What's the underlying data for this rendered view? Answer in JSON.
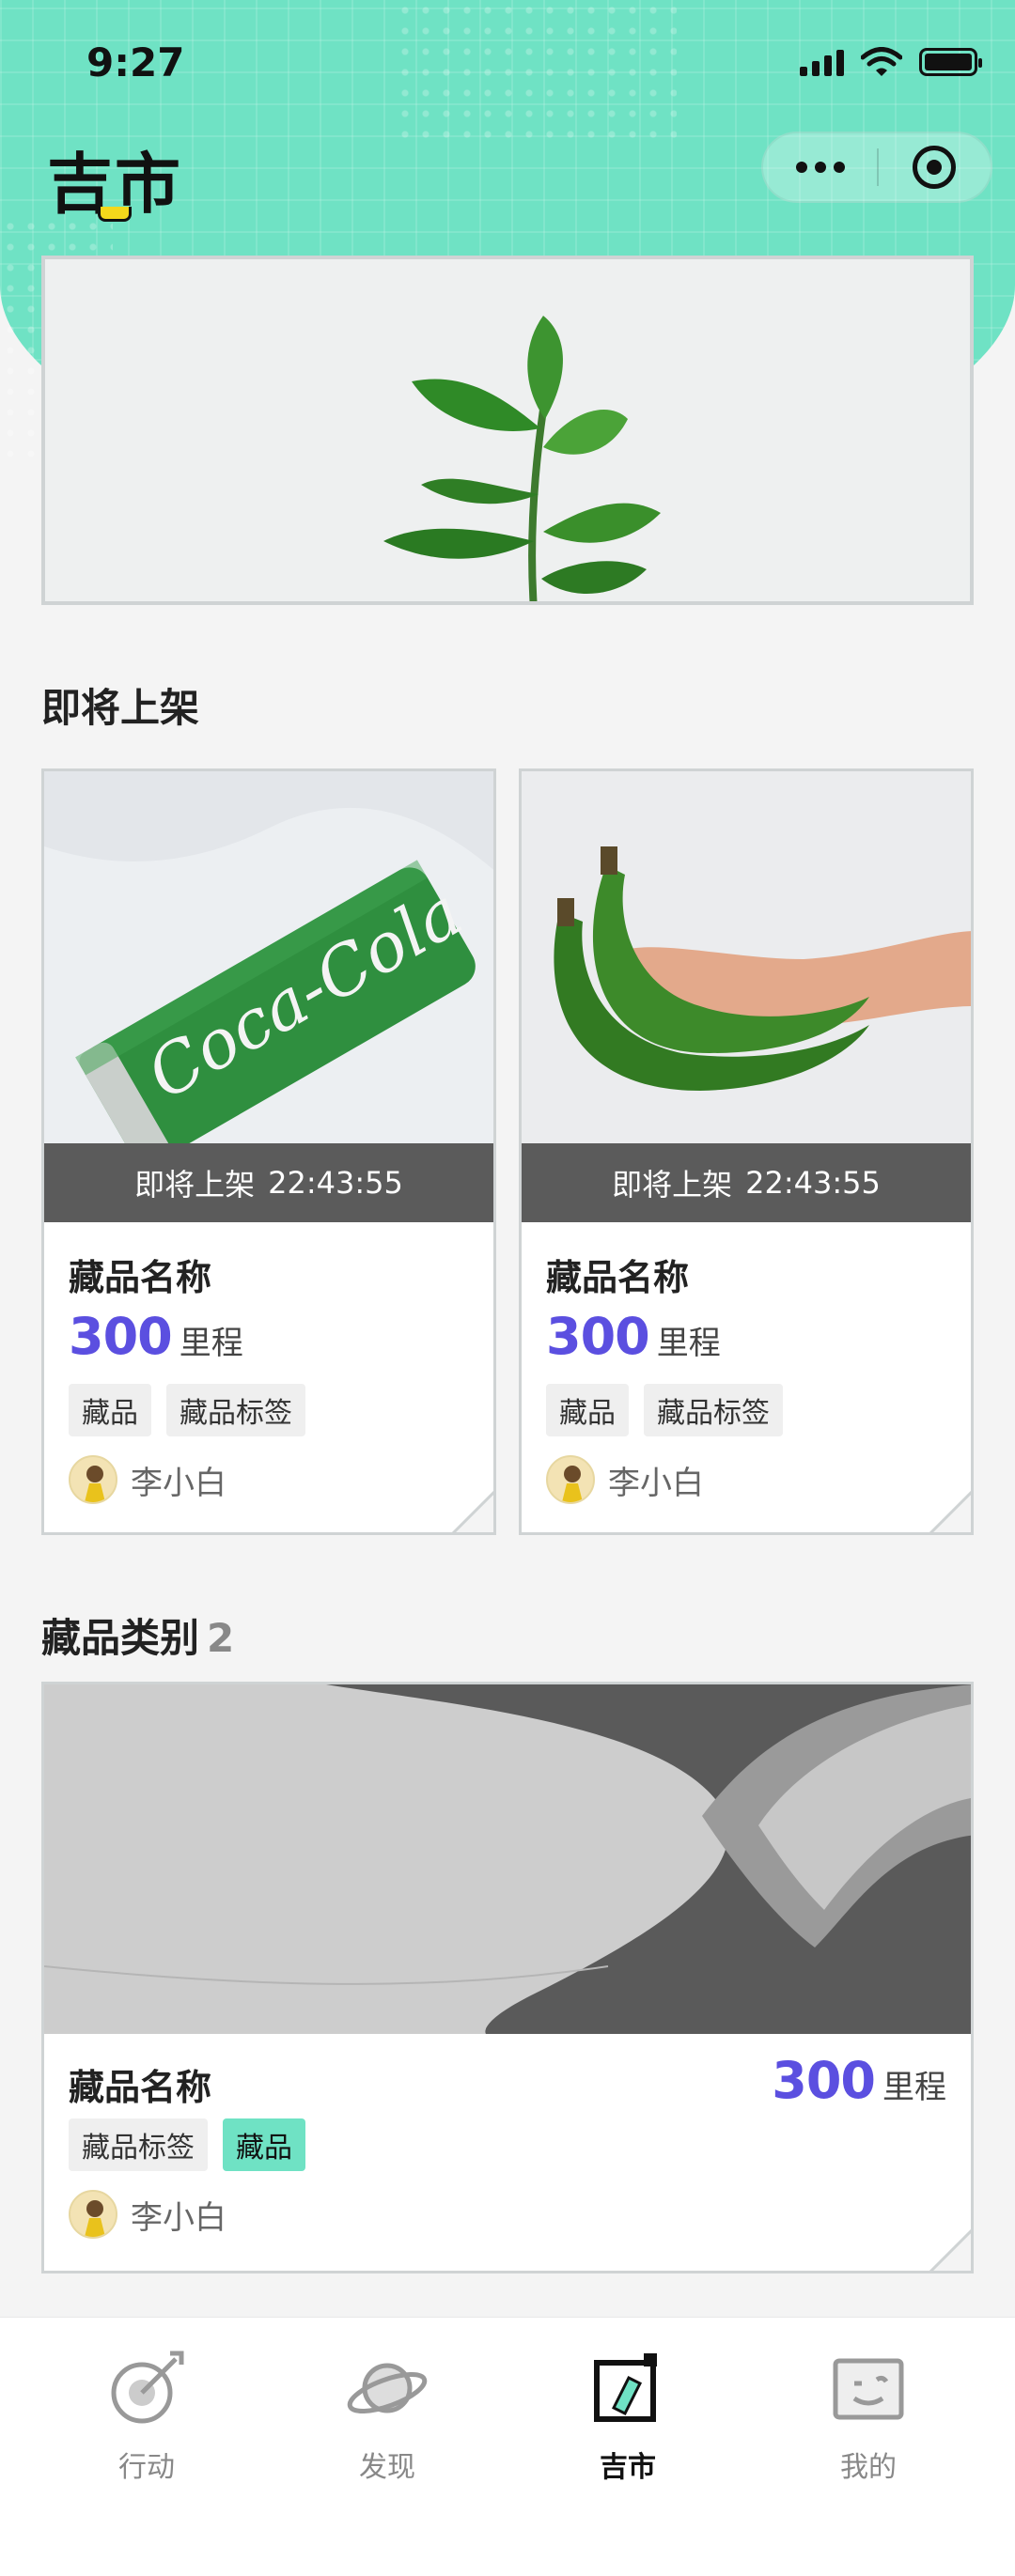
{
  "status_bar": {
    "time": "9:27"
  },
  "app": {
    "title": "吉市"
  },
  "upcoming": {
    "title": "即将上架",
    "items": [
      {
        "countdown_label": "即将上架",
        "countdown": "22:43:55",
        "name": "藏品名称",
        "price": "300",
        "unit": "里程",
        "tags": [
          "藏品",
          "藏品标签"
        ],
        "author": "李小白"
      },
      {
        "countdown_label": "即将上架",
        "countdown": "22:43:55",
        "name": "藏品名称",
        "price": "300",
        "unit": "里程",
        "tags": [
          "藏品",
          "藏品标签"
        ],
        "author": "李小白"
      }
    ]
  },
  "category": {
    "title": "藏品类别",
    "count": "2",
    "item": {
      "name": "藏品名称",
      "price": "300",
      "unit": "里程",
      "tags": [
        "藏品标签",
        "藏品"
      ],
      "author": "李小白"
    }
  },
  "tabbar": {
    "items": [
      {
        "label": "行动",
        "icon": "target-dart-icon"
      },
      {
        "label": "发现",
        "icon": "planet-icon"
      },
      {
        "label": "吉市",
        "icon": "market-icon",
        "active": true
      },
      {
        "label": "我的",
        "icon": "smile-face-icon"
      }
    ]
  },
  "colors": {
    "accent": "#6fe2c4",
    "price": "#5b4fe0",
    "overlay": "#5b5b5b"
  }
}
